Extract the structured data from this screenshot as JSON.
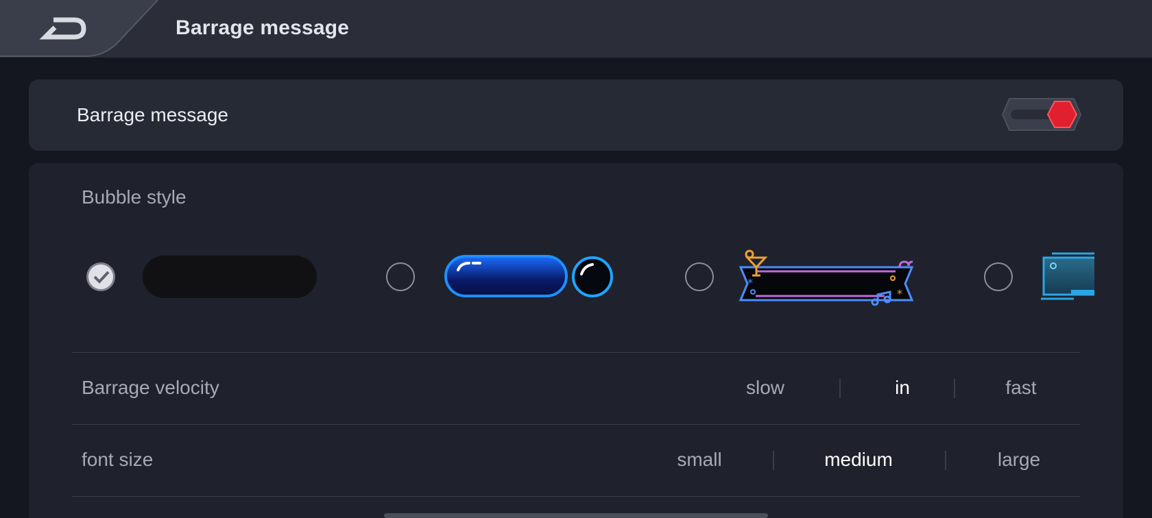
{
  "header": {
    "title": "Barrage message",
    "back_icon": "back-arrow-icon"
  },
  "toggle_card": {
    "label": "Barrage message",
    "switch_state": "on",
    "switch_color": "#e0202e"
  },
  "bubble_style": {
    "label": "Bubble style",
    "options": [
      {
        "name": "plain-black",
        "selected": true
      },
      {
        "name": "blue-glow",
        "selected": false
      },
      {
        "name": "neon-party",
        "selected": false
      },
      {
        "name": "tech-frame",
        "selected": false
      }
    ]
  },
  "velocity": {
    "label": "Barrage velocity",
    "options": [
      "slow",
      "in",
      "fast"
    ],
    "selected": "in"
  },
  "font_size": {
    "label": "font size",
    "options": [
      "small",
      "medium",
      "large"
    ],
    "selected": "medium"
  },
  "colors": {
    "accent": "#1e8fff",
    "background": "#14171f",
    "card": "#262a35"
  }
}
